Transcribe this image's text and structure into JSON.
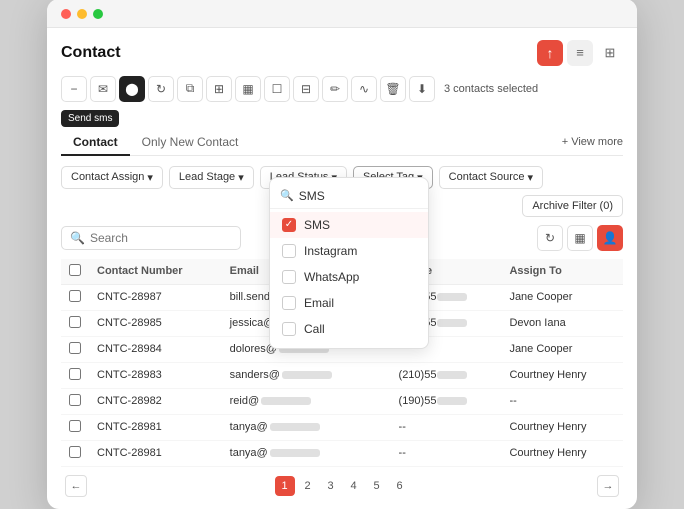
{
  "window": {
    "title": "Contact"
  },
  "header": {
    "title": "Contact",
    "selected_label": "3 contacts selected",
    "view_more": "+ View more"
  },
  "toolbar": {
    "buttons": [
      {
        "name": "minus-icon",
        "symbol": "−"
      },
      {
        "name": "email-icon",
        "symbol": "✉"
      },
      {
        "name": "tag-icon",
        "symbol": "⬤"
      },
      {
        "name": "refresh-icon",
        "symbol": "↻"
      },
      {
        "name": "copy-icon",
        "symbol": "⧉"
      },
      {
        "name": "grid-icon",
        "symbol": "⊞"
      },
      {
        "name": "chart-icon",
        "symbol": "≡"
      },
      {
        "name": "document-icon",
        "symbol": "⬜"
      },
      {
        "name": "table2-icon",
        "symbol": "⊟"
      },
      {
        "name": "brush-icon",
        "symbol": "✏"
      },
      {
        "name": "wave-icon",
        "symbol": "∿"
      },
      {
        "name": "trash-icon",
        "symbol": "🗑"
      },
      {
        "name": "download-icon",
        "symbol": "⬇"
      }
    ],
    "send_sms_label": "Send sms"
  },
  "tabs": [
    {
      "label": "Contact",
      "active": true
    },
    {
      "label": "Only New Contact",
      "active": false
    }
  ],
  "filters": [
    {
      "label": "Contact Assign",
      "name": "contact-assign-filter"
    },
    {
      "label": "Lead Stage",
      "name": "lead-stage-filter"
    },
    {
      "label": "Lead Status",
      "name": "lead-status-filter"
    },
    {
      "label": "Select Tag",
      "name": "select-tag-filter",
      "selected": true
    },
    {
      "label": "Contact Source",
      "name": "contact-source-filter"
    }
  ],
  "archive_btn": "Archive Filter (0)",
  "search": {
    "placeholder": "Search"
  },
  "table": {
    "columns": [
      "",
      "Contact Number",
      "Email",
      "Phone",
      "Assign To"
    ],
    "rows": [
      {
        "id": "CNTC-28987",
        "email": "bill.sender@",
        "phone": "(321)55",
        "assign": "Jane Cooper"
      },
      {
        "id": "CNTC-28985",
        "email": "jessica@",
        "phone": "(319)55",
        "assign": "Devon Iana"
      },
      {
        "id": "CNTC-28984",
        "email": "dolores@",
        "phone": "",
        "assign": "Jane Cooper"
      },
      {
        "id": "CNTC-28983",
        "email": "sanders@",
        "phone": "(210)55",
        "assign": "Courtney Henry"
      },
      {
        "id": "CNTC-28982",
        "email": "reid@",
        "phone": "(190)55",
        "assign": "--"
      },
      {
        "id": "CNTC-28981",
        "email": "tanya@",
        "phone": "--",
        "assign": "Courtney Henry"
      },
      {
        "id": "CNTC-28981",
        "email": "tanya@",
        "phone": "--",
        "assign": "Courtney Henry"
      }
    ]
  },
  "pagination": {
    "pages": [
      "1",
      "2",
      "3",
      "4",
      "5",
      "6"
    ],
    "active_page": "1",
    "prev_label": "←",
    "next_label": "→"
  },
  "dropdown": {
    "search_placeholder": "SMS",
    "items": [
      {
        "label": "SMS",
        "checked": true,
        "name": "sms-option"
      },
      {
        "label": "Instagram",
        "checked": false,
        "name": "instagram-option"
      },
      {
        "label": "WhatsApp",
        "checked": false,
        "name": "whatsapp-option"
      },
      {
        "label": "Email",
        "checked": false,
        "name": "email-option"
      },
      {
        "label": "Call",
        "checked": false,
        "name": "call-option"
      }
    ]
  },
  "right_action_icons": [
    {
      "name": "refresh2-icon",
      "symbol": "↻"
    },
    {
      "name": "bar-chart-icon",
      "symbol": "▦"
    },
    {
      "name": "user-red-icon",
      "symbol": "👤",
      "accent": true
    }
  ]
}
